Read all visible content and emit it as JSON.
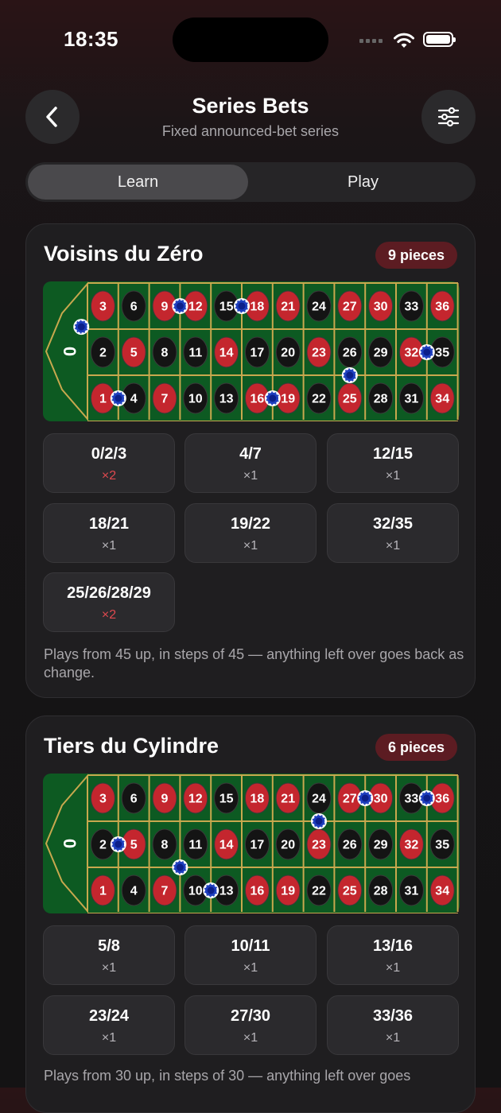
{
  "status": {
    "time": "18:35"
  },
  "header": {
    "title": "Series Bets",
    "subtitle": "Fixed announced-bet series"
  },
  "tabs": [
    {
      "label": "Learn",
      "active": true
    },
    {
      "label": "Play",
      "active": false
    }
  ],
  "colors": {
    "red": "#c4262e",
    "black": "#141414",
    "felt": "#0d5a22",
    "gold": "#c8a84e",
    "chip": "#1e3fbf",
    "pill": "#5c1c22"
  },
  "sections": [
    {
      "title": "Voisins du Zéro",
      "pieces": "9 pieces",
      "bets": [
        {
          "label": "0/2/3",
          "mult": "×2",
          "highlight": true
        },
        {
          "label": "4/7",
          "mult": "×1",
          "highlight": false
        },
        {
          "label": "12/15",
          "mult": "×1",
          "highlight": false
        },
        {
          "label": "18/21",
          "mult": "×1",
          "highlight": false
        },
        {
          "label": "19/22",
          "mult": "×1",
          "highlight": false
        },
        {
          "label": "32/35",
          "mult": "×1",
          "highlight": false
        },
        {
          "label": "25/26/28/29",
          "mult": "×2",
          "highlight": true
        }
      ],
      "note": "Plays from 45 up, in steps of 45 — anything left over goes back as change."
    },
    {
      "title": "Tiers du Cylindre",
      "pieces": "6 pieces",
      "bets": [
        {
          "label": "5/8",
          "mult": "×1",
          "highlight": false
        },
        {
          "label": "10/11",
          "mult": "×1",
          "highlight": false
        },
        {
          "label": "13/16",
          "mult": "×1",
          "highlight": false
        },
        {
          "label": "23/24",
          "mult": "×1",
          "highlight": false
        },
        {
          "label": "27/30",
          "mult": "×1",
          "highlight": false
        },
        {
          "label": "33/36",
          "mult": "×1",
          "highlight": false
        }
      ],
      "note": "Plays from 30 up, in steps of 30 — anything left over goes"
    }
  ],
  "table": {
    "zero": "0",
    "rows": [
      [
        "3",
        "6",
        "9",
        "12",
        "15",
        "18",
        "21",
        "24",
        "27",
        "30",
        "33",
        "36"
      ],
      [
        "2",
        "5",
        "8",
        "11",
        "14",
        "17",
        "20",
        "23",
        "26",
        "29",
        "32",
        "35"
      ],
      [
        "1",
        "4",
        "7",
        "10",
        "13",
        "16",
        "19",
        "22",
        "25",
        "28",
        "31",
        "34"
      ]
    ],
    "red_numbers": [
      "1",
      "3",
      "5",
      "7",
      "9",
      "12",
      "14",
      "16",
      "18",
      "19",
      "21",
      "23",
      "25",
      "27",
      "30",
      "32",
      "34",
      "36"
    ]
  }
}
